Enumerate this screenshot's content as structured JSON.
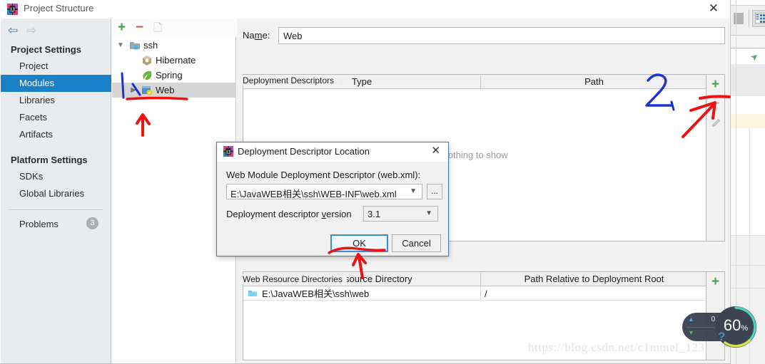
{
  "window": {
    "title": "Project Structure",
    "app_icon": "intellij-idea-icon",
    "close_label": "✕"
  },
  "sidebar": {
    "nav": {
      "back_icon": "arrow-left-icon",
      "forward_icon": "arrow-right-icon"
    },
    "groups": [
      {
        "title": "Project Settings",
        "items": [
          {
            "label": "Project",
            "selected": false
          },
          {
            "label": "Modules",
            "selected": true
          },
          {
            "label": "Libraries",
            "selected": false
          },
          {
            "label": "Facets",
            "selected": false
          },
          {
            "label": "Artifacts",
            "selected": false
          }
        ]
      },
      {
        "title": "Platform Settings",
        "items": [
          {
            "label": "SDKs",
            "selected": false
          },
          {
            "label": "Global Libraries",
            "selected": false
          }
        ]
      }
    ],
    "problems": {
      "label": "Problems",
      "count": "3"
    },
    "selection_color": "#1a80c8",
    "background": "#e8ecef"
  },
  "tree": {
    "toolbar": {
      "add_label": "+",
      "remove_label": "−",
      "copy_icon": "copy-icon"
    },
    "nodes": [
      {
        "label": "ssh",
        "icon": "module-folder-icon",
        "indent": 0,
        "chevron": "⌄",
        "expanded": true,
        "selected": false
      },
      {
        "label": "Hibernate",
        "icon": "hibernate-icon",
        "indent": 1,
        "chevron": "",
        "expanded": false,
        "selected": false
      },
      {
        "label": "Spring",
        "icon": "spring-leaf-icon",
        "indent": 1,
        "chevron": "",
        "expanded": false,
        "selected": false
      },
      {
        "label": "Web",
        "icon": "web-facet-icon",
        "indent": 1,
        "chevron": "›",
        "expanded": false,
        "selected": true
      }
    ]
  },
  "main": {
    "name_field": {
      "label": "Name:",
      "label_mnemonic": "m",
      "value": "Web"
    },
    "deployment_descriptors": {
      "section_title": "Deployment Descriptors",
      "columns": [
        "Type",
        "Path"
      ],
      "rows": [],
      "empty_text": "Nothing to show",
      "toolbar": {
        "add": "+",
        "remove": "−",
        "edit_icon": "pencil-icon"
      }
    },
    "web_resource_directories": {
      "section_title": "Web Resource Directories",
      "columns": [
        "Web Resource Directory",
        "Path Relative to Deployment Root"
      ],
      "rows": [
        {
          "directory": "E:\\JavaWEB相关\\ssh\\web",
          "relative_path": "/",
          "icon": "folder-icon"
        }
      ],
      "toolbar": {
        "add": "+"
      }
    }
  },
  "dialog": {
    "title": "Deployment Descriptor Location",
    "app_icon": "intellij-idea-icon",
    "close_label": "✕",
    "descriptor_label": "Web Module Deployment Descriptor (web.xml):",
    "descriptor_value": "E:\\JavaWEB相关\\ssh\\WEB-INF\\web.xml",
    "browse_label": "...",
    "version_label": "Deployment descriptor version",
    "version_label_mnemonic": "v",
    "version_value": "3.1",
    "ok_label": "OK",
    "cancel_label": "Cancel"
  },
  "annotations": {
    "step_two_label": "2.",
    "step_two_color": "#1a33cc",
    "marker_color": "#ee1111",
    "notes": [
      "red-underline-under-web-node",
      "red-arrow-up-below-web-node",
      "blue-handwritten-2-near-path-column",
      "red-arrow-pointing-to-add-descriptor-button",
      "red-underline-under-ok-button",
      "red-arrow-up-to-ok-button"
    ]
  },
  "network_widget": {
    "upload": "0.5K/s",
    "download": "0K/s",
    "upload_icon": "arrow-up-icon",
    "download_icon": "arrow-down-icon",
    "gauge_value": "60",
    "gauge_unit": "%",
    "help_icon": "question-mark-icon"
  },
  "watermark": {
    "text": "https://blog.csdn.net/c1mmei_123"
  }
}
